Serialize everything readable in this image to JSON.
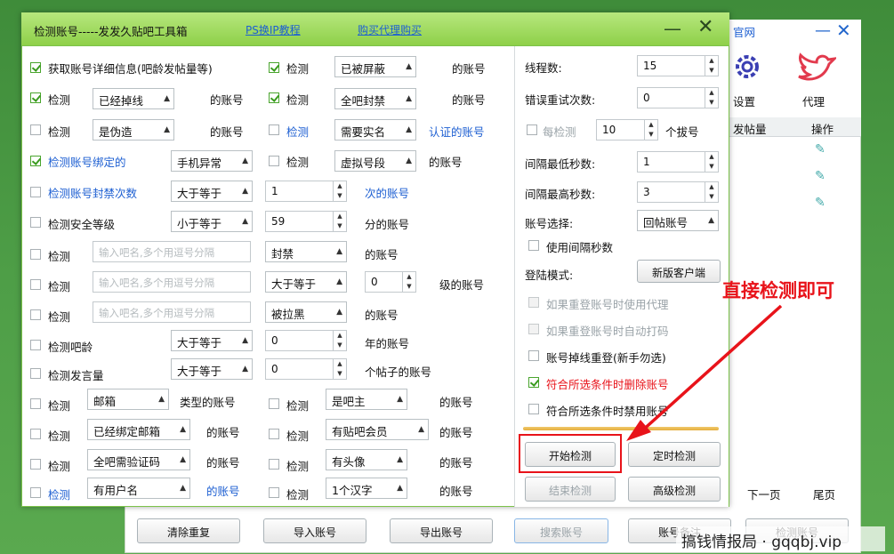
{
  "bg": {
    "tab_label": "官网",
    "settings_label": "设置",
    "proxy_label": "代理",
    "col_posts": "发帖量",
    "col_ops": "操作",
    "btn_clear": "清除重复",
    "btn_import": "导入账号",
    "btn_export": "导出账号",
    "btn_search": "搜索账号",
    "btn_account": "账号备注",
    "btn_check": "检测账号",
    "next_page": "下一页",
    "last_page": "尾页",
    "watermark": "搞钱情报局 · gqqbj.vip"
  },
  "dialog": {
    "title": "检测账号-----发发久贴吧工具箱",
    "link_video": "PS换IP教程",
    "link_buy": "购买代理购买",
    "min_icon": "minimize-icon",
    "close_icon": "close-icon"
  },
  "left": {
    "r1_label": "获取账号详细信息(吧龄发帖量等)",
    "r2_check": "检测",
    "r2_dd": "已经掉线",
    "r2_suffix": "的账号",
    "r3_check": "检测",
    "r3_dd": "是伪造",
    "r3_suffix": "的账号",
    "r4_label": "检测账号绑定的",
    "r4_dd": "手机异常",
    "r5_label": "检测账号封禁次数",
    "r5_dd": "大于等于",
    "r5_val": "1",
    "r5_suffix": "次的账号",
    "r6_label": "检测安全等级",
    "r6_dd": "小于等于",
    "r6_val": "59",
    "r6_suffix": "分的账号",
    "r7_check": "检测",
    "r7_ph": "输入吧名,多个用逗号分隔",
    "r7_dd": "封禁",
    "r7_suffix": "的账号",
    "r8_check": "检测",
    "r8_ph": "输入吧名,多个用逗号分隔",
    "r8_dd": "大于等于",
    "r8_val": "0",
    "r8_suffix": "级的账号",
    "r9_check": "检测",
    "r9_ph": "输入吧名,多个用逗号分隔",
    "r9_dd": "被拉黑",
    "r9_suffix": "的账号",
    "r10_label": "检测吧龄",
    "r10_dd": "大于等于",
    "r10_val": "0",
    "r10_suffix": "年的账号",
    "r11_label": "检测发言量",
    "r11_dd": "大于等于",
    "r11_val": "0",
    "r11_suffix": "个帖子的账号",
    "r12_check": "检测",
    "r12_dd": "邮箱",
    "r12_suffix": "类型的账号",
    "r13_check": "检测",
    "r13_dd": "已经绑定邮箱",
    "r13_suffix": "的账号",
    "r14_check": "检测",
    "r14_dd": "全吧需验证码",
    "r14_suffix": "的账号",
    "r15_check": "检测",
    "r15_dd": "有用户名",
    "r15_suffix": "的账号"
  },
  "mid": {
    "m1_check": "检测",
    "m1_dd": "已被屏蔽",
    "m1_suffix": "的账号",
    "m2_check": "检测",
    "m2_dd": "全吧封禁",
    "m2_suffix": "的账号",
    "m3_check": "检测",
    "m3_dd": "需要实名",
    "m3_suffix": "认证的账号",
    "m4_check": "检测",
    "m4_dd": "虚拟号段",
    "m4_suffix": "的账号",
    "m12_check": "检测",
    "m12_dd": "是吧主",
    "m12_suffix": "的账号",
    "m13_check": "检测",
    "m13_dd": "有贴吧会员",
    "m13_suffix": "的账号",
    "m14_check": "检测",
    "m14_dd": "有头像",
    "m14_suffix": "的账号",
    "m15_check": "检测",
    "m15_dd": "1个汉字",
    "m15_suffix": "的账号"
  },
  "right": {
    "threads_label": "线程数:",
    "threads_val": "15",
    "retry_label": "错误重试次数:",
    "retry_val": "0",
    "every_label": "每检测",
    "every_val": "10",
    "every_suffix": "个拔号",
    "min_label": "间隔最低秒数:",
    "min_val": "1",
    "max_label": "间隔最高秒数:",
    "max_val": "3",
    "acct_label": "账号选择:",
    "acct_dd": "回帖账号",
    "use_interval": "使用间隔秒数",
    "login_label": "登陆模式:",
    "login_btn": "新版客户端",
    "o1": "如果重登账号时使用代理",
    "o2": "如果重登账号时自动打码",
    "o3": "账号掉线重登(新手勿选)",
    "o4": "符合所选条件时删除账号",
    "o5": "符合所选条件时禁用账号",
    "btn_start": "开始检测",
    "btn_timer": "定时检测",
    "btn_stop": "结束检测",
    "btn_adv": "高级检测"
  },
  "annotation": {
    "text": "直接检测即可",
    "color": "#e8131a"
  },
  "colors": {
    "title_bar": "#9bd85a",
    "link_blue": "#1d5fd2",
    "accent_red": "#e8131a",
    "check_green": "#3a9b1f"
  }
}
